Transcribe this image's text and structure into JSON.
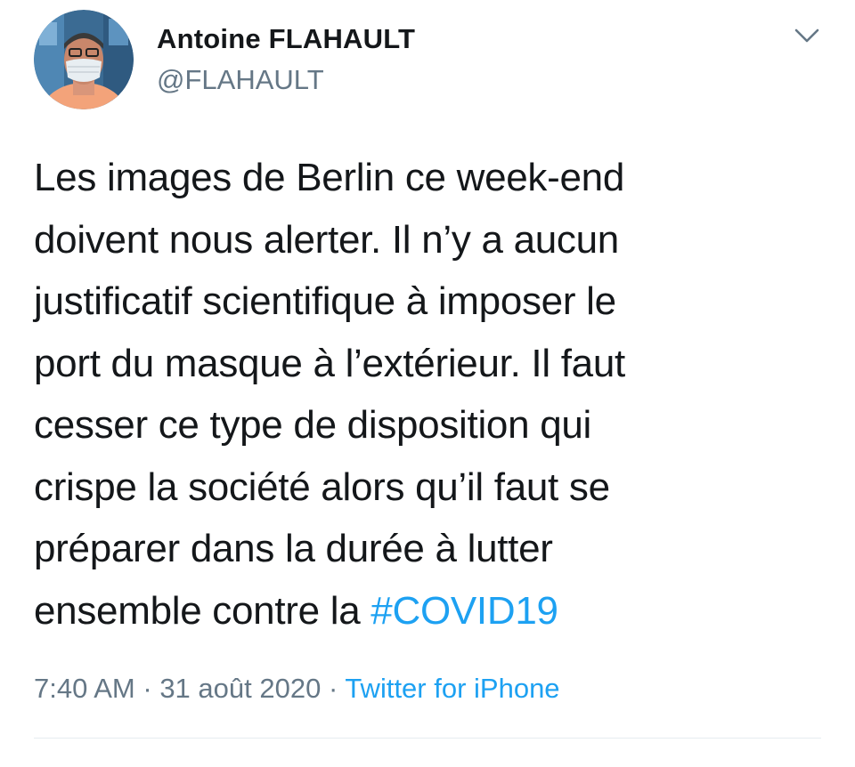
{
  "author": {
    "display_name": "Antoine FLAHAULT",
    "handle": "@FLAHAULT"
  },
  "tweet": {
    "lines": [
      "Les images de Berlin ce week-end",
      "doivent nous alerter. Il n’y a aucun",
      "justificatif scientifique à imposer le",
      "port du masque à l’extérieur. Il faut",
      "cesser ce type de disposition qui",
      "crispe la société alors qu’il faut se",
      "préparer dans la durée à lutter",
      "ensemble contre la "
    ],
    "hashtag": "#COVID19"
  },
  "meta": {
    "time": "7:40 AM",
    "separator": " · ",
    "date": "31 août 2020",
    "separator2": " · ",
    "source": "Twitter for iPhone"
  },
  "icons": {
    "menu": "chevron-down-icon",
    "avatar": "avatar"
  },
  "colors": {
    "text": "#14171a",
    "secondary": "#657786",
    "accent": "#1da1f2",
    "divider": "#e6ecf0"
  }
}
